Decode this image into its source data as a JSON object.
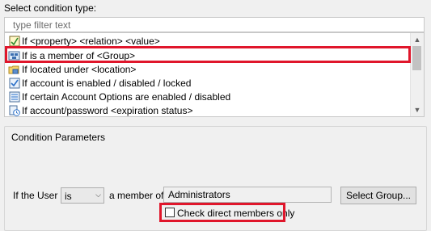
{
  "header": {
    "title": "Select condition type:"
  },
  "filter": {
    "placeholder": "type filter text"
  },
  "conditions": [
    {
      "label": "If <property> <relation> <value>",
      "icon": "property-condition-icon"
    },
    {
      "label": "If is a member of <Group>",
      "icon": "group-member-icon"
    },
    {
      "label": "If located under <location>",
      "icon": "folder-location-icon"
    },
    {
      "label": "If account is enabled / disabled / locked",
      "icon": "account-status-icon"
    },
    {
      "label": "If certain Account Options are enabled / disabled",
      "icon": "account-options-icon"
    },
    {
      "label": "If account/password <expiration status>",
      "icon": "expiration-clock-icon"
    }
  ],
  "params": {
    "title": "Condition Parameters",
    "if_the_user": "If the User",
    "relation_value": "is",
    "member_of": "a member of",
    "group_value": "Administrators",
    "select_group": "Select Group...",
    "check_direct": "Check direct members only"
  },
  "colors": {
    "highlight": "#e0162b"
  }
}
